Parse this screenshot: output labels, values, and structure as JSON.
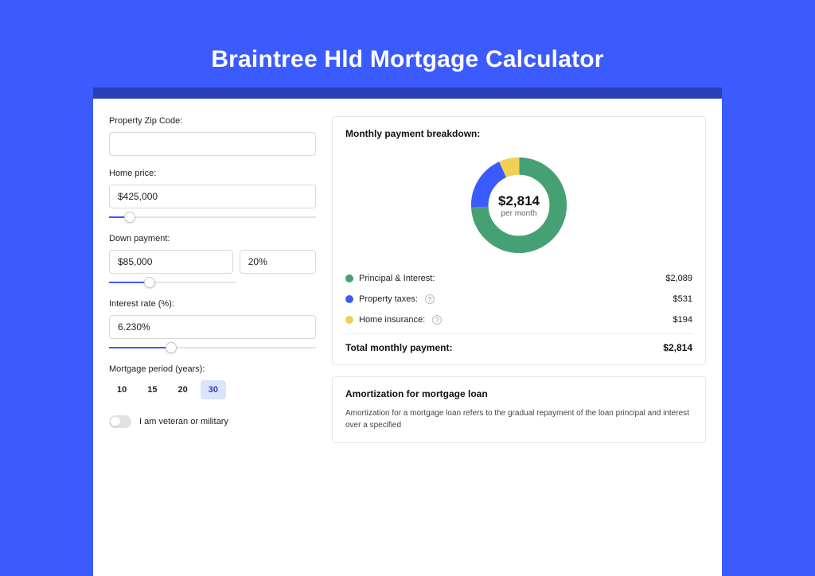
{
  "title": "Braintree Hld Mortgage Calculator",
  "form": {
    "zip_label": "Property Zip Code:",
    "zip_value": "",
    "home_price_label": "Home price:",
    "home_price_value": "$425,000",
    "down_payment_label": "Down payment:",
    "down_payment_value": "$85,000",
    "down_payment_pct": "20%",
    "interest_label": "Interest rate (%):",
    "interest_value": "6.230%",
    "period_label": "Mortgage period (years):",
    "period_options": [
      "10",
      "15",
      "20",
      "30"
    ],
    "period_active": "30",
    "veteran_label": "I am veteran or military"
  },
  "breakdown": {
    "title": "Monthly payment breakdown:",
    "center_value": "$2,814",
    "center_sub": "per month",
    "items": [
      {
        "label": "Principal & Interest:",
        "value": "$2,089",
        "color": "#45a074",
        "help": false
      },
      {
        "label": "Property taxes:",
        "value": "$531",
        "color": "#3b5bff",
        "help": true
      },
      {
        "label": "Home insurance:",
        "value": "$194",
        "color": "#f2cf55",
        "help": true
      }
    ],
    "total_label": "Total monthly payment:",
    "total_value": "$2,814"
  },
  "amortization": {
    "title": "Amortization for mortgage loan",
    "text": "Amortization for a mortgage loan refers to the gradual repayment of the loan principal and interest over a specified"
  },
  "chart_data": {
    "type": "pie",
    "title": "Monthly payment breakdown",
    "series": [
      {
        "name": "Principal & Interest",
        "value": 2089,
        "color": "#45a074"
      },
      {
        "name": "Property taxes",
        "value": 531,
        "color": "#3b5bff"
      },
      {
        "name": "Home insurance",
        "value": 194,
        "color": "#f2cf55"
      }
    ],
    "total": 2814,
    "center_label": "$2,814 per month"
  }
}
